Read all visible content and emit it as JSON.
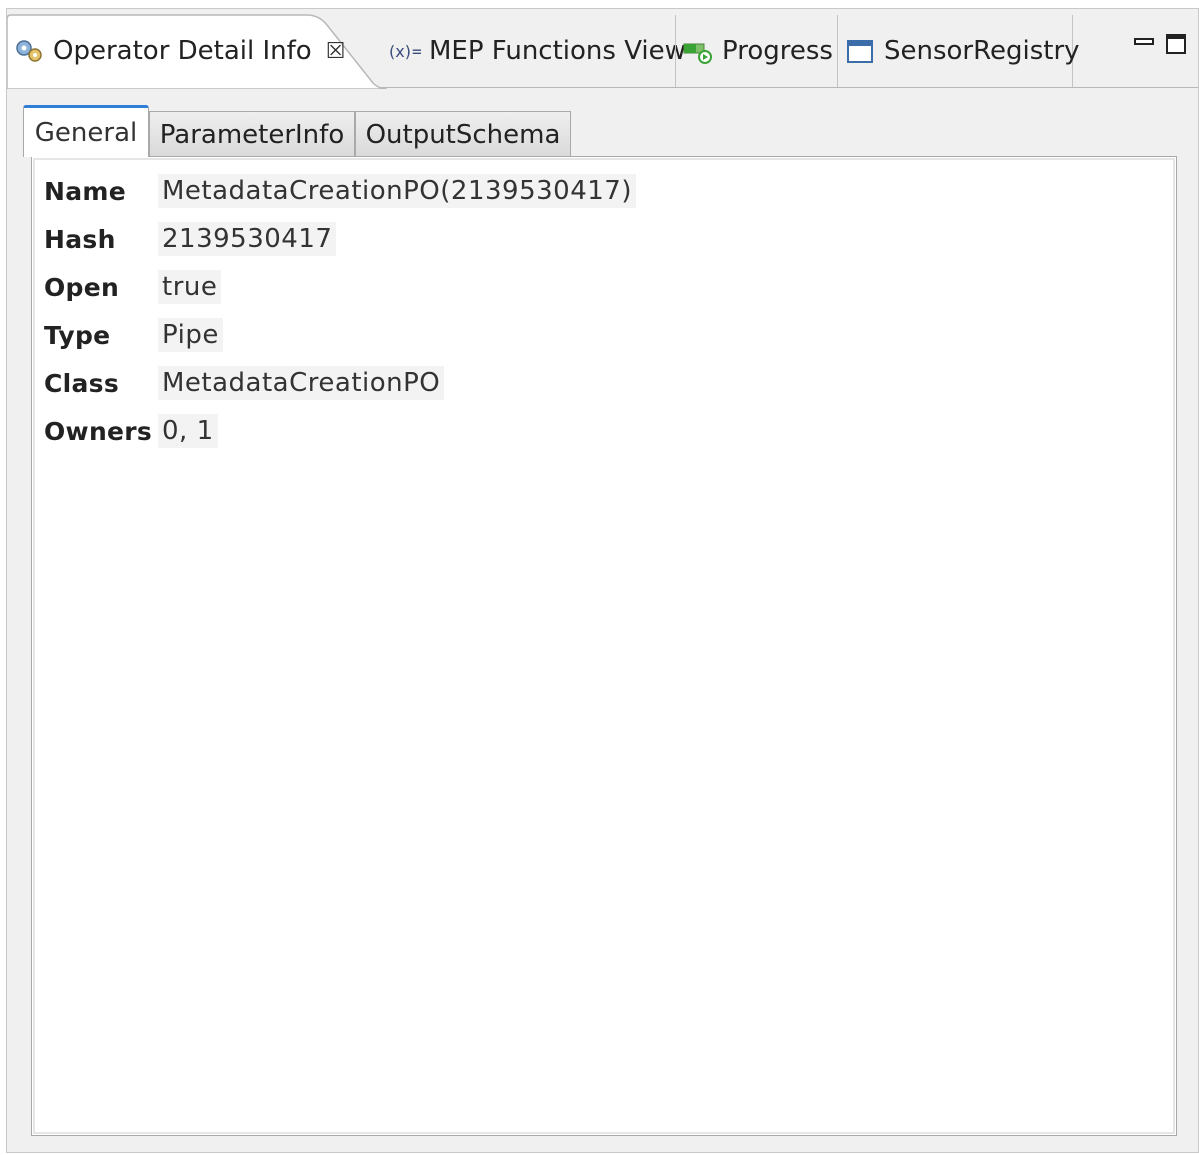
{
  "view_tabs": [
    {
      "label": "Operator Detail Info",
      "icon": "operator-gear-icon",
      "active": true
    },
    {
      "label": "MEP Functions View",
      "icon": "function-x-icon",
      "active": false
    },
    {
      "label": "Progress",
      "icon": "progress-bar-icon",
      "active": false
    },
    {
      "label": "SensorRegistry",
      "icon": "window-icon",
      "active": false
    }
  ],
  "close_glyph": "☒",
  "inner_tabs": [
    {
      "label": "General",
      "active": true
    },
    {
      "label": "ParameterInfo",
      "active": false
    },
    {
      "label": "OutputSchema",
      "active": false
    }
  ],
  "properties": [
    {
      "label": "Name",
      "value": "MetadataCreationPO(2139530417)"
    },
    {
      "label": "Hash",
      "value": "2139530417"
    },
    {
      "label": "Open",
      "value": "true"
    },
    {
      "label": "Type",
      "value": "Pipe"
    },
    {
      "label": "Class",
      "value": "MetadataCreationPO"
    },
    {
      "label": "Owners",
      "value": "0, 1"
    }
  ],
  "colors": {
    "accent": "#2f7fd8",
    "panel_bg": "#f0f0f0",
    "progress_green": "#3aa336"
  }
}
